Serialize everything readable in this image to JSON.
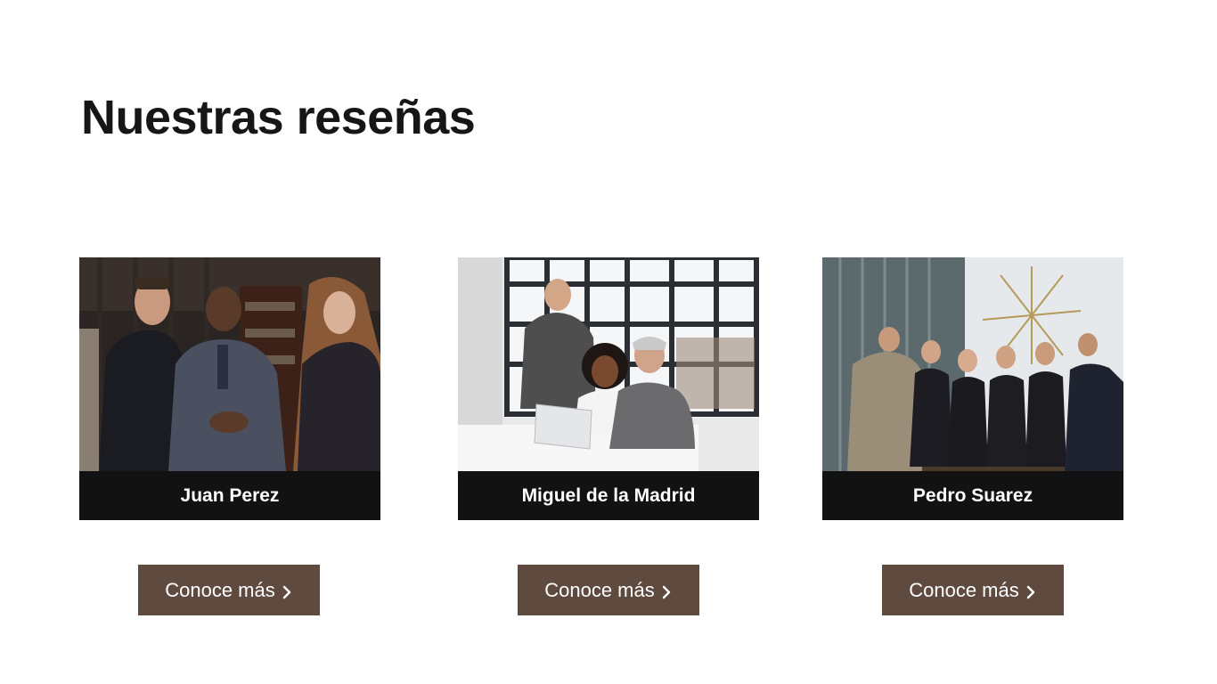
{
  "section": {
    "title": "Nuestras reseñas"
  },
  "cards": [
    {
      "name": "Juan Perez",
      "button_label": "Conoce más",
      "icon": "chevron-right-icon"
    },
    {
      "name": "Miguel de la Madrid",
      "button_label": "Conoce más",
      "icon": "chevron-right-icon"
    },
    {
      "name": "Pedro Suarez",
      "button_label": "Conoce más",
      "icon": "chevron-right-icon"
    }
  ],
  "colors": {
    "title": "#161616",
    "name_bar": "#121212",
    "button_bg": "#5e4a3f",
    "button_text": "#ffffff"
  }
}
